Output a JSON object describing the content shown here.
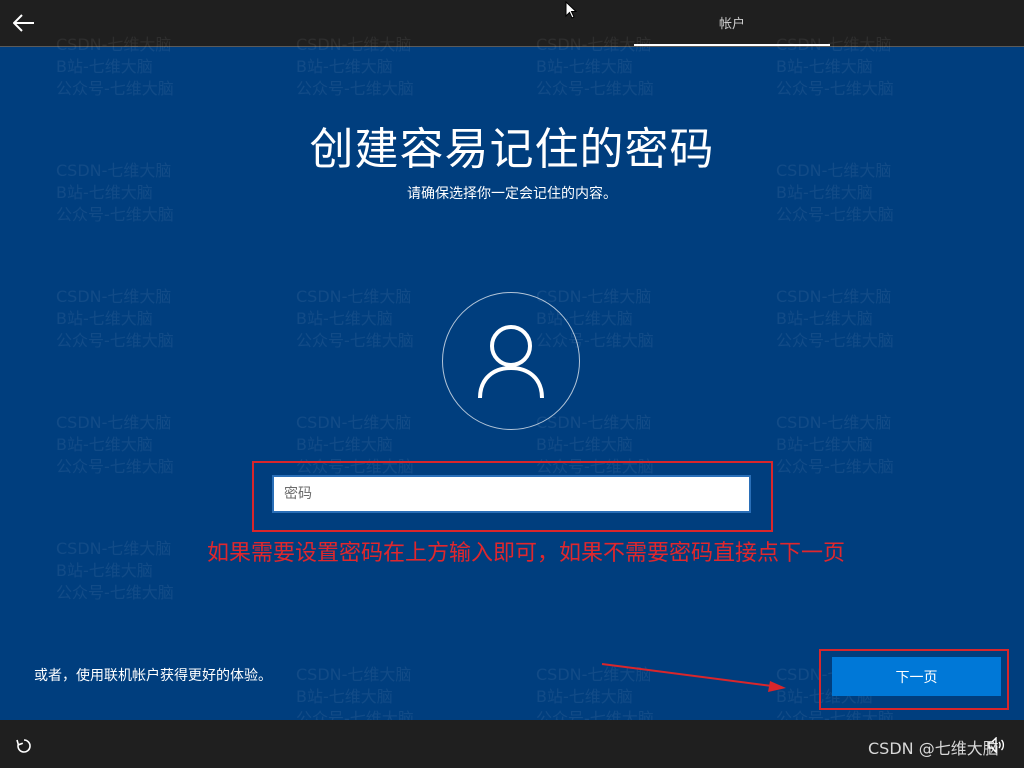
{
  "header": {
    "tab_account": "帐户"
  },
  "watermark": {
    "lines": "CSDN-七维大脑\nB站-七维大脑\n公众号-七维大脑"
  },
  "main": {
    "title": "创建容易记住的密码",
    "subtitle": "请确保选择你一定会记住的内容。",
    "password_placeholder": "密码",
    "password_value": ""
  },
  "annotation": {
    "text": "如果需要设置密码在上方输入即可，如果不需要密码直接点下一页",
    "color": "#e0272d"
  },
  "footer": {
    "alt_text": "或者，使用联机帐户获得更好的体验。",
    "next_label": "下一页",
    "credit": "CSDN @七维大脑"
  },
  "colors": {
    "background": "#003e7e",
    "bar": "#1f1f1f",
    "accent": "#0078d7",
    "annotation_red": "#d9262b"
  },
  "icons": {
    "back": "back-arrow-icon",
    "avatar": "user-icon",
    "accessibility": "accessibility-icon",
    "volume": "volume-icon",
    "cursor": "mouse-cursor-icon"
  }
}
